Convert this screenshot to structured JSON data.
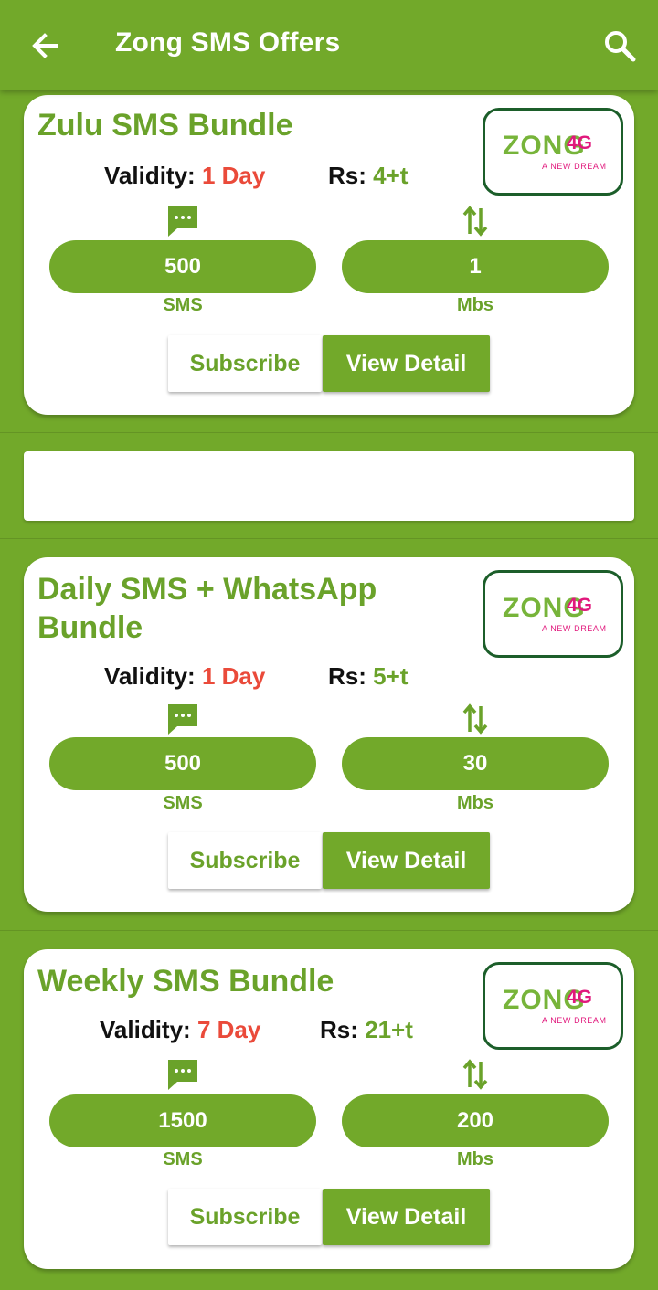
{
  "appbar": {
    "title": "Zong SMS Offers",
    "back_icon": "arrow-left-icon",
    "search_icon": "search-icon"
  },
  "logo": {
    "brand": "ZONG",
    "suffix": "4G",
    "tagline": "A NEW DREAM"
  },
  "colors": {
    "primary": "#72a92a",
    "title_green": "#6aa22a",
    "validity_red": "#ea4a3a",
    "logo_pink": "#e1187c"
  },
  "labels": {
    "validity": "Validity:",
    "price": "Rs:",
    "subscribe": "Subscribe",
    "view_detail": "View Detail"
  },
  "offers": [
    {
      "title": "Zulu SMS Bundle",
      "validity": "1 Day",
      "price": "4+t",
      "sms": "500",
      "sms_unit": "SMS",
      "data": "1",
      "data_unit": "Mbs"
    },
    {
      "title": "Daily SMS + WhatsApp Bundle",
      "validity": "1 Day",
      "price": "5+t",
      "sms": "500",
      "sms_unit": "SMS",
      "data": "30",
      "data_unit": "Mbs"
    },
    {
      "title": "Weekly SMS Bundle",
      "validity": "7 Day",
      "price": "21+t",
      "sms": "1500",
      "sms_unit": "SMS",
      "data": "200",
      "data_unit": "Mbs"
    }
  ]
}
